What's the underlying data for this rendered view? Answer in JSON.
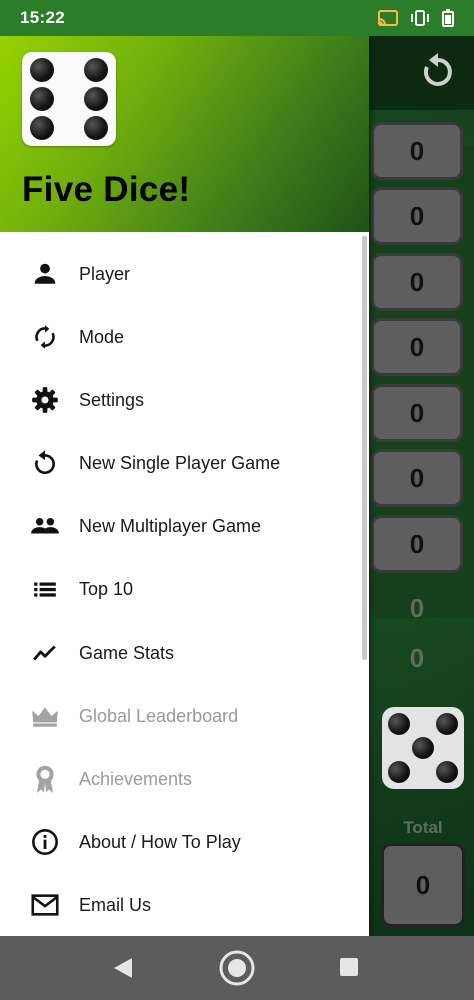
{
  "status_bar": {
    "time": "15:22"
  },
  "app": {
    "title": "Five Dice!"
  },
  "menu": {
    "items": [
      {
        "label": "Player",
        "icon": "person-icon",
        "enabled": true
      },
      {
        "label": "Mode",
        "icon": "sync-icon",
        "enabled": true
      },
      {
        "label": "Settings",
        "icon": "gear-icon",
        "enabled": true
      },
      {
        "label": "New Single Player Game",
        "icon": "restart-icon",
        "enabled": true
      },
      {
        "label": "New Multiplayer Game",
        "icon": "group-icon",
        "enabled": true
      },
      {
        "label": "Top 10",
        "icon": "list-icon",
        "enabled": true
      },
      {
        "label": "Game Stats",
        "icon": "trending-icon",
        "enabled": true
      },
      {
        "label": "Global Leaderboard",
        "icon": "crown-icon",
        "enabled": false
      },
      {
        "label": "Achievements",
        "icon": "award-icon",
        "enabled": false
      },
      {
        "label": "About / How To Play",
        "icon": "info-icon",
        "enabled": true
      },
      {
        "label": "Email Us",
        "icon": "mail-icon",
        "enabled": true
      }
    ]
  },
  "game": {
    "scores": [
      "0",
      "0",
      "0",
      "0",
      "0",
      "0",
      "0"
    ],
    "bonus_values": [
      "0",
      "0"
    ],
    "die_face": 5,
    "total_label": "Total",
    "total_value": "0"
  },
  "colors": {
    "status_bar": "#2c7d2a",
    "header_gradient_start": "#96d200",
    "header_gradient_end": "#1e5217",
    "nav_bar": "#5c5c5c"
  }
}
